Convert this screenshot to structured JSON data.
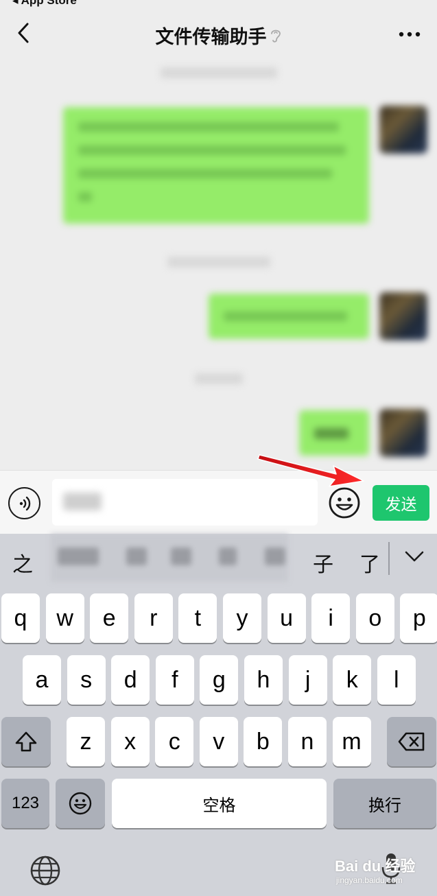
{
  "status": {
    "back_to_app": "◂ App Store"
  },
  "nav": {
    "title": "文件传输助手",
    "back_icon": "chevron-left-icon",
    "more_icon": "ellipsis-icon",
    "mute_icon": "ear-icon"
  },
  "input": {
    "value": "",
    "send_label": "发送",
    "voice_icon": "voice-icon",
    "emoji_icon": "emoji-icon"
  },
  "candidates": {
    "first": "之",
    "second": "子",
    "third": "了",
    "collapse_icon": "chevron-down-icon"
  },
  "keyboard": {
    "row1": [
      "q",
      "w",
      "e",
      "r",
      "t",
      "y",
      "u",
      "i",
      "o",
      "p"
    ],
    "row2": [
      "a",
      "s",
      "d",
      "f",
      "g",
      "h",
      "j",
      "k",
      "l"
    ],
    "row3": [
      "z",
      "x",
      "c",
      "v",
      "b",
      "n",
      "m"
    ],
    "numbers_label": "123",
    "space_label": "空格",
    "return_label": "换行",
    "shift_icon": "shift-icon",
    "delete_icon": "delete-icon",
    "emoji_key_icon": "emoji-icon",
    "globe_icon": "globe-icon",
    "mic_icon": "microphone-icon"
  },
  "watermark": {
    "brand": "Bai du 经验",
    "url": "jingyan.baidu.com"
  },
  "colors": {
    "bubble": "#95ec69",
    "send": "#07c160",
    "arrow": "#e8141b"
  }
}
